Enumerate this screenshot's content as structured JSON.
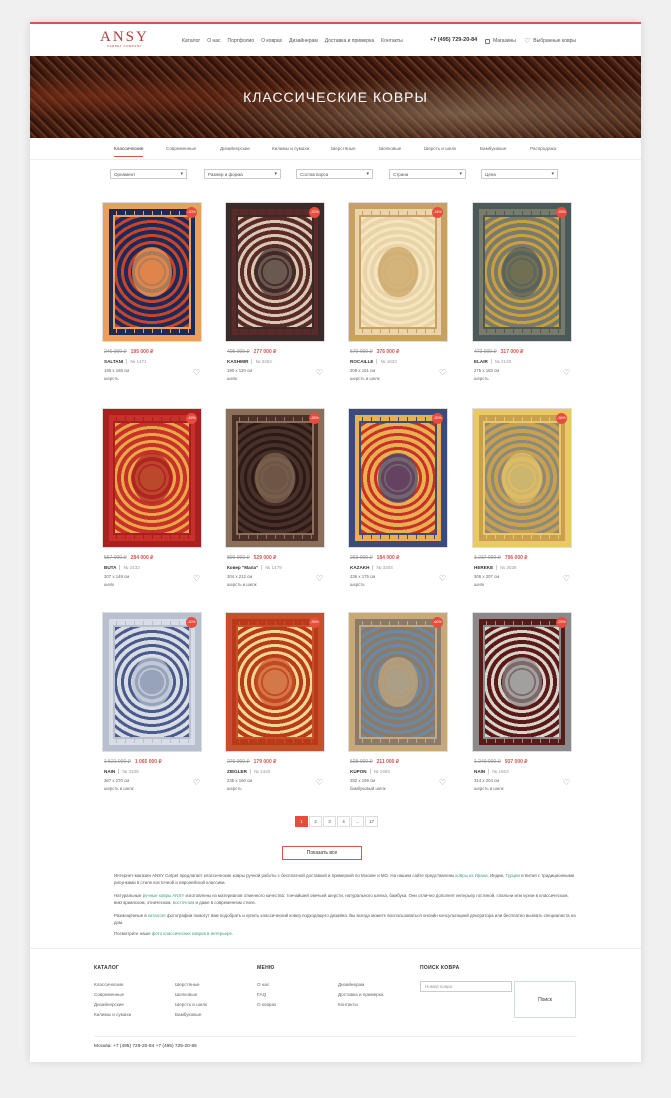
{
  "header": {
    "logo": "ANSY",
    "logo_sub": "CARPET COMPANY",
    "nav": [
      "Каталог",
      "О нас",
      "Портфолио",
      "О коврах",
      "Дизайнерам",
      "Доставка и примерка",
      "Контакты"
    ],
    "phone": "+7 (495) 729-20-84",
    "stores_label": "Магазины",
    "favorites_label": "Выбранные ковры"
  },
  "hero": {
    "title": "КЛАССИЧЕСКИЕ КОВРЫ"
  },
  "categories": [
    "Классические",
    "Современные",
    "Дизайнерские",
    "Килимы и сумахи",
    "Шерстяные",
    "Шелковые",
    "Шерсть и шелк",
    "Бамбуковые",
    "Распродажа"
  ],
  "filters": [
    "Орнамент",
    "Размер и форма",
    "Состав ворса",
    "Страна",
    "Цена"
  ],
  "products": [
    {
      "old": "246 000 ₽",
      "new": "195 000 ₽",
      "name": "SALTANI",
      "sku": "№ 1471",
      "size": "195 x 168 см",
      "material": "шерсть",
      "badge": "-20%",
      "colors": [
        "#1c2a5a",
        "#c8442a",
        "#e8a05a"
      ]
    },
    {
      "old": "405 000 ₽",
      "new": "277 000 ₽",
      "name": "KASHMIR",
      "sku": "№ 3264",
      "size": "190 x 120 см",
      "material": "шелк",
      "badge": "-32%",
      "colors": [
        "#5a2a28",
        "#d8c8b0",
        "#3a2a2a"
      ]
    },
    {
      "old": "570 000 ₽",
      "new": "376 000 ₽",
      "name": "ROCAILLE",
      "sku": "№ 1632",
      "size": "209 x 151 см",
      "material": "шерсть и шелк",
      "badge": "-34%",
      "colors": [
        "#e8d4a8",
        "#f4e4c0",
        "#c8a060"
      ]
    },
    {
      "old": "472 000 ₽",
      "new": "317 000 ₽",
      "name": "ELAIR",
      "sku": "№ 2120",
      "size": "275 x 183 см",
      "material": "шерсть",
      "badge": "-33%",
      "colors": [
        "#7a7a6a",
        "#c8a040",
        "#4a5a5a"
      ]
    },
    {
      "old": "557 000 ₽",
      "new": "284 000 ₽",
      "name": "BUTA",
      "sku": "№ 2433",
      "size": "207 x 148 см",
      "material": "шелк",
      "badge": "-49%",
      "colors": [
        "#c8302a",
        "#e8a848",
        "#a82020"
      ]
    },
    {
      "old": "809 000 ₽",
      "new": "529 000 ₽",
      "name": "Ковер \"Мала\"",
      "sku": "№ 1479",
      "size": "304 x 212 см",
      "material": "шерсть и шелк",
      "badge": "-35%",
      "colors": [
        "#4a3028",
        "#2a1a18",
        "#8a7058"
      ]
    },
    {
      "old": "263 000 ₽",
      "new": "184 000 ₽",
      "name": "KAZAKH",
      "sku": "№ 3304",
      "size": "236 x 175 см",
      "material": "шерсть",
      "badge": "-30%",
      "colors": [
        "#e8b050",
        "#c83028",
        "#3a4a7a"
      ]
    },
    {
      "old": "1 237 000 ₽",
      "new": "796 000 ₽",
      "name": "HEREKE",
      "sku": "№ 3036",
      "size": "306 x 207 см",
      "material": "шелк",
      "badge": "-36%",
      "colors": [
        "#c8a050",
        "#8a8a7a",
        "#e8c868"
      ]
    },
    {
      "old": "1 521 000 ₽",
      "new": "1 065 000 ₽",
      "name": "NAIN",
      "sku": "№ 3338",
      "size": "367 x 270 см",
      "material": "шерсть и шелк",
      "badge": "-30%",
      "colors": [
        "#d8dce4",
        "#4a5a8a",
        "#b8c0d0"
      ]
    },
    {
      "old": "276 000 ₽",
      "new": "179 000 ₽",
      "name": "ZIEGLER",
      "sku": "№ 1340",
      "size": "235 x 160 см",
      "material": "шерсть",
      "badge": "-35%",
      "colors": [
        "#b83a1a",
        "#f0d890",
        "#c85028"
      ]
    },
    {
      "old": "528 000 ₽",
      "new": "211 000 ₽",
      "name": "KUPON",
      "sku": "№ 1680",
      "size": "282 x 199 см",
      "material": "бамбуковый шелк",
      "badge": "-60%",
      "colors": [
        "#8a7a6a",
        "#6a8aa8",
        "#c8a878"
      ]
    },
    {
      "old": "1 249 000 ₽",
      "new": "937 000 ₽",
      "name": "NAIN",
      "sku": "№ 1653",
      "size": "314 x 204 см",
      "material": "шерсть и шелк",
      "badge": "-25%",
      "colors": [
        "#5a1a18",
        "#d8d4cc",
        "#8a8a8a"
      ]
    }
  ],
  "pagination": [
    "1",
    "2",
    "3",
    "4",
    "...",
    "17"
  ],
  "show_all": "Показать все",
  "seo": [
    {
      "pre": "Интернет-магазин ANSY Carpet предлагает классические ковры ручной работы с бесплатной доставкой и примеркой по Москве и МО. На нашем сайте представлены ",
      "link": "ковры из Ирана",
      "post": ", Индии, ",
      "link2": "Турции",
      "post2": " и Китая с традиционными рисунками в стиле восточной и европейской классики."
    },
    {
      "pre": "Натуральные ",
      "link": "ручные ковры ANSY",
      "post": " изготовлены из материалов отменного качества: тончайшей овечьей шерсти, натурального шелка, бамбука. Они отлично дополнят интерьер гостиной, спальни или кухни в классическом, викторианском, этническом, ",
      "link2": "восточном",
      "post2": " и даже в современном стиле."
    },
    {
      "pre": "Размещённые в ",
      "link": "каталоге",
      "post": " фотографии помогут вам подобрать и купить классический ковер подходящего дизайна. Вы всегда можете воспользоваться онлайн консультацией декоратора или бесплатно вызвать специалиста на дом.",
      "link2": "",
      "post2": ""
    },
    {
      "pre": "Посмотрите наше ",
      "link": "фото классических ковров в интерьере",
      "post": ".",
      "link2": "",
      "post2": ""
    }
  ],
  "footer": {
    "catalog_title": "КАТАЛОГ",
    "catalog_col1": [
      "Классические",
      "Современные",
      "Дизайнерские",
      "Килимы и сумахи"
    ],
    "catalog_col2": [
      "Шерстяные",
      "Шелковые",
      "Шерсть и шелк",
      "Бамбуковые"
    ],
    "menu_title": "МЕНЮ",
    "menu_col1": [
      "О нас",
      "FAQ",
      "О коврах"
    ],
    "menu_col2": [
      "Дизайнерам",
      "Доставка и примерка",
      "Контакты"
    ],
    "search_title": "ПОИСК КОВРА",
    "search_placeholder": "Номер ковра",
    "search_button": "Поиск",
    "contacts": "Москва:   +7 (495) 729-20-84   +7 (495) 725-20-85"
  }
}
